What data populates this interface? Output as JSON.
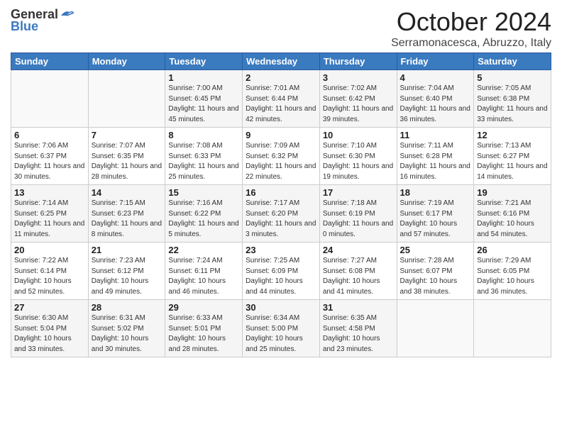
{
  "header": {
    "logo_general": "General",
    "logo_blue": "Blue",
    "month_title": "October 2024",
    "location": "Serramonacesca, Abruzzo, Italy"
  },
  "days_of_week": [
    "Sunday",
    "Monday",
    "Tuesday",
    "Wednesday",
    "Thursday",
    "Friday",
    "Saturday"
  ],
  "weeks": [
    [
      {
        "day": "",
        "sunrise": "",
        "sunset": "",
        "daylight": ""
      },
      {
        "day": "",
        "sunrise": "",
        "sunset": "",
        "daylight": ""
      },
      {
        "day": "1",
        "sunrise": "Sunrise: 7:00 AM",
        "sunset": "Sunset: 6:45 PM",
        "daylight": "Daylight: 11 hours and 45 minutes."
      },
      {
        "day": "2",
        "sunrise": "Sunrise: 7:01 AM",
        "sunset": "Sunset: 6:44 PM",
        "daylight": "Daylight: 11 hours and 42 minutes."
      },
      {
        "day": "3",
        "sunrise": "Sunrise: 7:02 AM",
        "sunset": "Sunset: 6:42 PM",
        "daylight": "Daylight: 11 hours and 39 minutes."
      },
      {
        "day": "4",
        "sunrise": "Sunrise: 7:04 AM",
        "sunset": "Sunset: 6:40 PM",
        "daylight": "Daylight: 11 hours and 36 minutes."
      },
      {
        "day": "5",
        "sunrise": "Sunrise: 7:05 AM",
        "sunset": "Sunset: 6:38 PM",
        "daylight": "Daylight: 11 hours and 33 minutes."
      }
    ],
    [
      {
        "day": "6",
        "sunrise": "Sunrise: 7:06 AM",
        "sunset": "Sunset: 6:37 PM",
        "daylight": "Daylight: 11 hours and 30 minutes."
      },
      {
        "day": "7",
        "sunrise": "Sunrise: 7:07 AM",
        "sunset": "Sunset: 6:35 PM",
        "daylight": "Daylight: 11 hours and 28 minutes."
      },
      {
        "day": "8",
        "sunrise": "Sunrise: 7:08 AM",
        "sunset": "Sunset: 6:33 PM",
        "daylight": "Daylight: 11 hours and 25 minutes."
      },
      {
        "day": "9",
        "sunrise": "Sunrise: 7:09 AM",
        "sunset": "Sunset: 6:32 PM",
        "daylight": "Daylight: 11 hours and 22 minutes."
      },
      {
        "day": "10",
        "sunrise": "Sunrise: 7:10 AM",
        "sunset": "Sunset: 6:30 PM",
        "daylight": "Daylight: 11 hours and 19 minutes."
      },
      {
        "day": "11",
        "sunrise": "Sunrise: 7:11 AM",
        "sunset": "Sunset: 6:28 PM",
        "daylight": "Daylight: 11 hours and 16 minutes."
      },
      {
        "day": "12",
        "sunrise": "Sunrise: 7:13 AM",
        "sunset": "Sunset: 6:27 PM",
        "daylight": "Daylight: 11 hours and 14 minutes."
      }
    ],
    [
      {
        "day": "13",
        "sunrise": "Sunrise: 7:14 AM",
        "sunset": "Sunset: 6:25 PM",
        "daylight": "Daylight: 11 hours and 11 minutes."
      },
      {
        "day": "14",
        "sunrise": "Sunrise: 7:15 AM",
        "sunset": "Sunset: 6:23 PM",
        "daylight": "Daylight: 11 hours and 8 minutes."
      },
      {
        "day": "15",
        "sunrise": "Sunrise: 7:16 AM",
        "sunset": "Sunset: 6:22 PM",
        "daylight": "Daylight: 11 hours and 5 minutes."
      },
      {
        "day": "16",
        "sunrise": "Sunrise: 7:17 AM",
        "sunset": "Sunset: 6:20 PM",
        "daylight": "Daylight: 11 hours and 3 minutes."
      },
      {
        "day": "17",
        "sunrise": "Sunrise: 7:18 AM",
        "sunset": "Sunset: 6:19 PM",
        "daylight": "Daylight: 11 hours and 0 minutes."
      },
      {
        "day": "18",
        "sunrise": "Sunrise: 7:19 AM",
        "sunset": "Sunset: 6:17 PM",
        "daylight": "Daylight: 10 hours and 57 minutes."
      },
      {
        "day": "19",
        "sunrise": "Sunrise: 7:21 AM",
        "sunset": "Sunset: 6:16 PM",
        "daylight": "Daylight: 10 hours and 54 minutes."
      }
    ],
    [
      {
        "day": "20",
        "sunrise": "Sunrise: 7:22 AM",
        "sunset": "Sunset: 6:14 PM",
        "daylight": "Daylight: 10 hours and 52 minutes."
      },
      {
        "day": "21",
        "sunrise": "Sunrise: 7:23 AM",
        "sunset": "Sunset: 6:12 PM",
        "daylight": "Daylight: 10 hours and 49 minutes."
      },
      {
        "day": "22",
        "sunrise": "Sunrise: 7:24 AM",
        "sunset": "Sunset: 6:11 PM",
        "daylight": "Daylight: 10 hours and 46 minutes."
      },
      {
        "day": "23",
        "sunrise": "Sunrise: 7:25 AM",
        "sunset": "Sunset: 6:09 PM",
        "daylight": "Daylight: 10 hours and 44 minutes."
      },
      {
        "day": "24",
        "sunrise": "Sunrise: 7:27 AM",
        "sunset": "Sunset: 6:08 PM",
        "daylight": "Daylight: 10 hours and 41 minutes."
      },
      {
        "day": "25",
        "sunrise": "Sunrise: 7:28 AM",
        "sunset": "Sunset: 6:07 PM",
        "daylight": "Daylight: 10 hours and 38 minutes."
      },
      {
        "day": "26",
        "sunrise": "Sunrise: 7:29 AM",
        "sunset": "Sunset: 6:05 PM",
        "daylight": "Daylight: 10 hours and 36 minutes."
      }
    ],
    [
      {
        "day": "27",
        "sunrise": "Sunrise: 6:30 AM",
        "sunset": "Sunset: 5:04 PM",
        "daylight": "Daylight: 10 hours and 33 minutes."
      },
      {
        "day": "28",
        "sunrise": "Sunrise: 6:31 AM",
        "sunset": "Sunset: 5:02 PM",
        "daylight": "Daylight: 10 hours and 30 minutes."
      },
      {
        "day": "29",
        "sunrise": "Sunrise: 6:33 AM",
        "sunset": "Sunset: 5:01 PM",
        "daylight": "Daylight: 10 hours and 28 minutes."
      },
      {
        "day": "30",
        "sunrise": "Sunrise: 6:34 AM",
        "sunset": "Sunset: 5:00 PM",
        "daylight": "Daylight: 10 hours and 25 minutes."
      },
      {
        "day": "31",
        "sunrise": "Sunrise: 6:35 AM",
        "sunset": "Sunset: 4:58 PM",
        "daylight": "Daylight: 10 hours and 23 minutes."
      },
      {
        "day": "",
        "sunrise": "",
        "sunset": "",
        "daylight": ""
      },
      {
        "day": "",
        "sunrise": "",
        "sunset": "",
        "daylight": ""
      }
    ]
  ]
}
